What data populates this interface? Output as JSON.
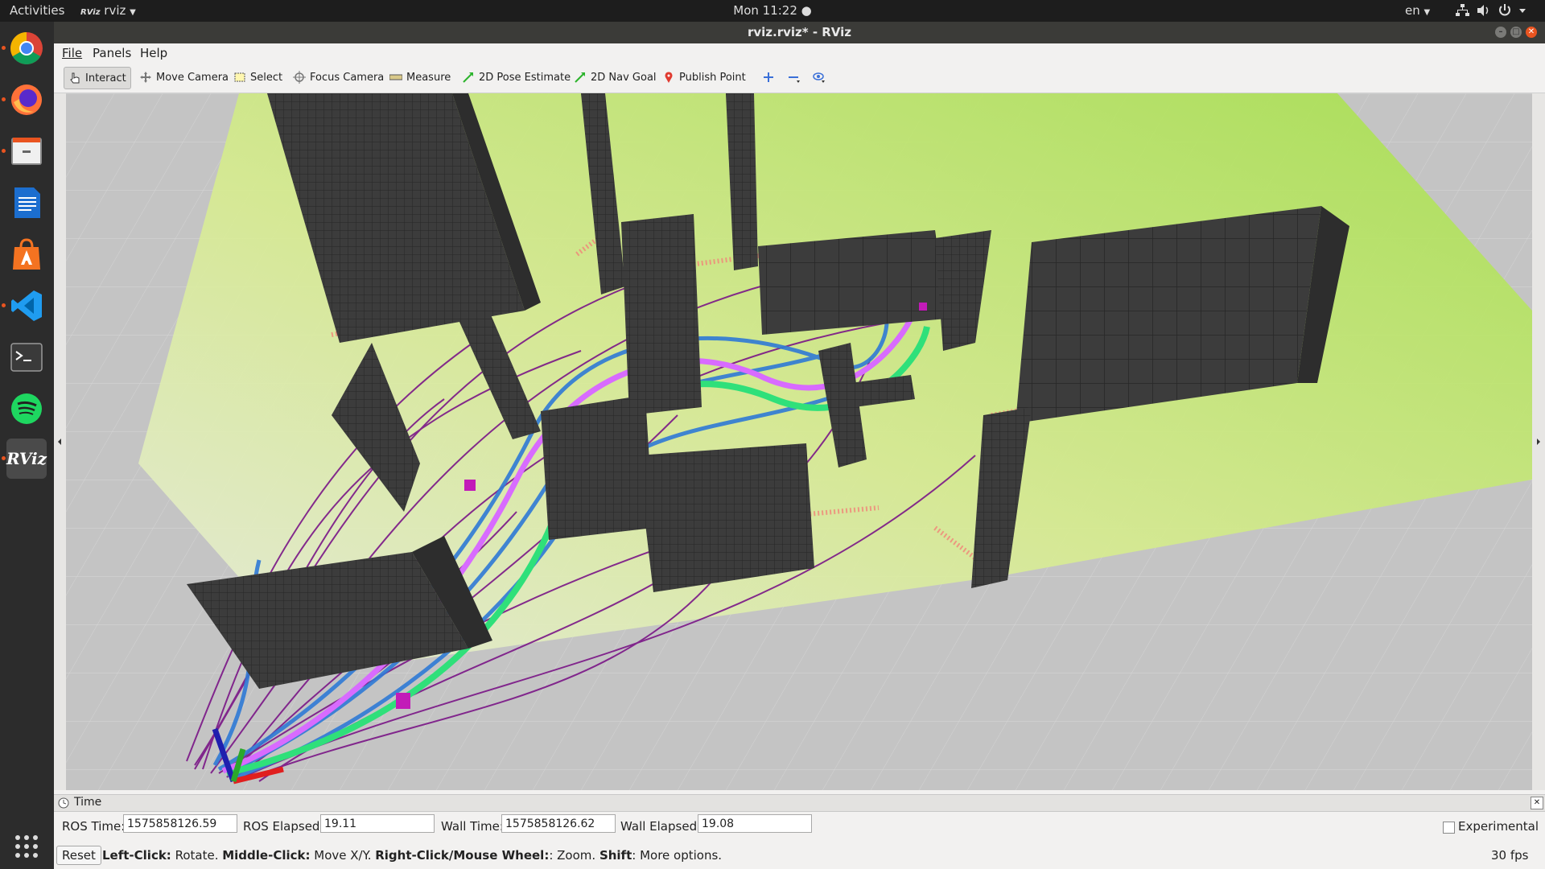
{
  "topbar": {
    "activities": "Activities",
    "app_name": "rviz",
    "app_badge": "RViz",
    "clock": "Mon 11:22 ●",
    "language": "en"
  },
  "dock": {
    "items": [
      {
        "name": "chrome-icon",
        "running": true
      },
      {
        "name": "firefox-icon",
        "running": true
      },
      {
        "name": "files-icon",
        "running": true
      },
      {
        "name": "writer-icon",
        "running": false
      },
      {
        "name": "software-icon",
        "running": false
      },
      {
        "name": "vscode-icon",
        "running": true
      },
      {
        "name": "terminal-icon",
        "running": false
      },
      {
        "name": "spotify-icon",
        "running": false
      },
      {
        "name": "rviz-icon",
        "running": true
      }
    ],
    "rviz_label": "RViz"
  },
  "window": {
    "title": "rviz.rviz* - RViz"
  },
  "menubar": {
    "file": "File",
    "panels": "Panels",
    "help": "Help"
  },
  "toolbar": {
    "interact": "Interact",
    "move_camera": "Move Camera",
    "select": "Select",
    "focus_camera": "Focus Camera",
    "measure": "Measure",
    "pose_estimate": "2D Pose Estimate",
    "nav_goal": "2D Nav Goal",
    "publish_point": "Publish Point"
  },
  "time_panel": {
    "title": "Time",
    "ros_time_label": "ROS Time:",
    "ros_time_value": "1575858126.59",
    "ros_elapsed_label": "ROS Elapsed:",
    "ros_elapsed_value": "19.11",
    "wall_time_label": "Wall Time:",
    "wall_time_value": "1575858126.62",
    "wall_elapsed_label": "Wall Elapsed:",
    "wall_elapsed_value": "19.08",
    "experimental_label": "Experimental"
  },
  "status": {
    "reset_label": "Reset",
    "left_click": "Left-Click:",
    "left_desc": " Rotate. ",
    "middle_click": "Middle-Click:",
    "middle_desc": " Move X/Y. ",
    "right_click": "Right-Click/Mouse Wheel:",
    "right_desc": ": Zoom. ",
    "shift": "Shift",
    "shift_desc": ": More options.",
    "fps": "30 fps"
  },
  "colors": {
    "ground": "#c4c4c4",
    "costmap": "#b6e05a",
    "obstacles": "#3a3a3a",
    "trajectories_purple": "#7a1687",
    "trajectories_blue": "#2f7ad6",
    "trajectory_green": "#2fe07a",
    "trajectory_pink": "#d86bff"
  }
}
